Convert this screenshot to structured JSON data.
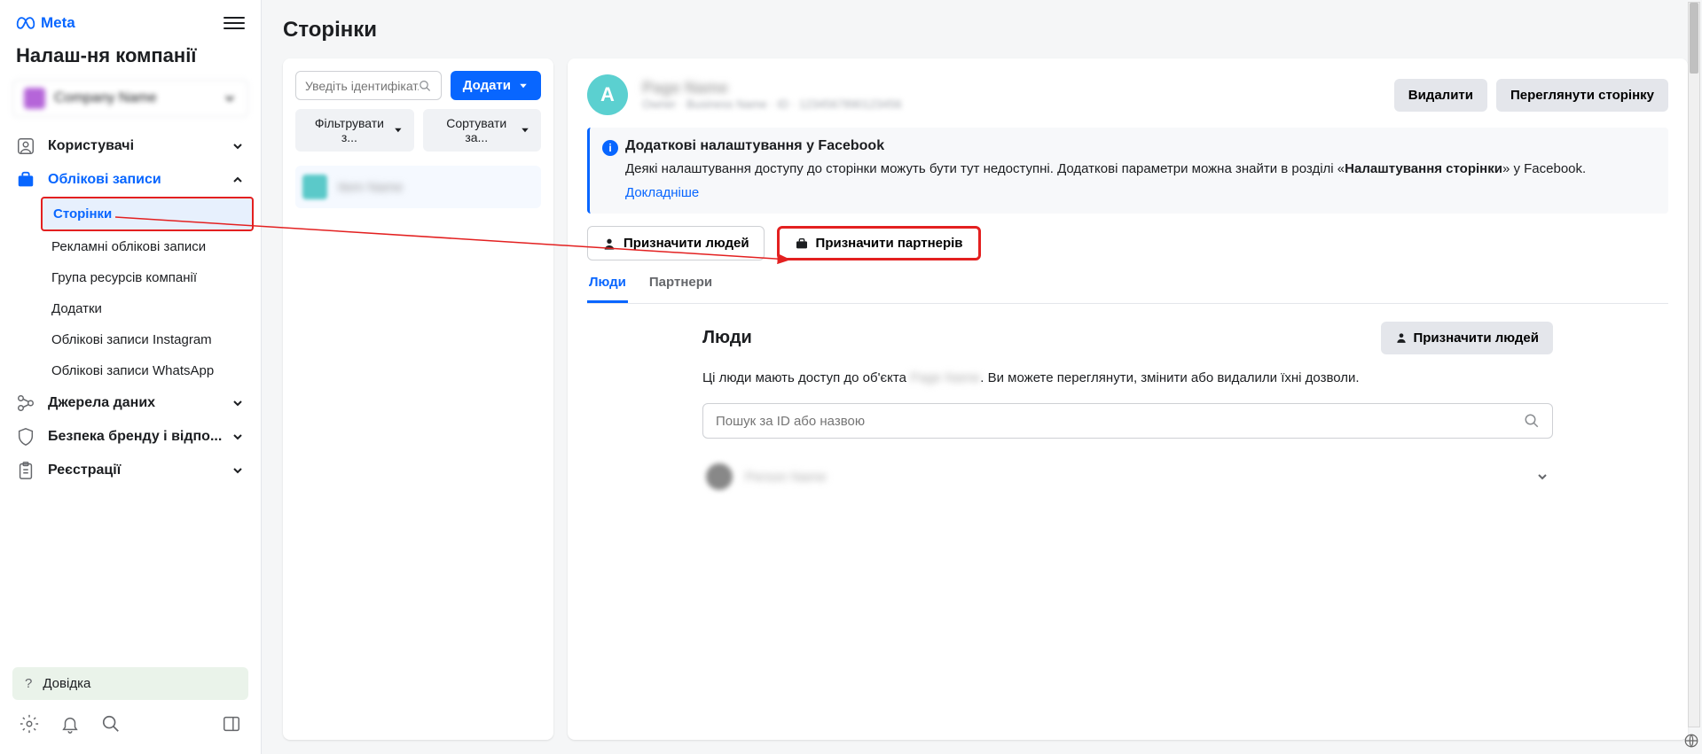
{
  "brand": "Meta",
  "sidebar_title": "Налаш-ня компанії",
  "company_name": "Company Name",
  "nav": {
    "users": "Користувачі",
    "accounts": "Облікові записи",
    "pages": "Сторінки",
    "ad_accounts": "Рекламні облікові записи",
    "asset_groups": "Група ресурсів компанії",
    "apps": "Додатки",
    "instagram": "Облікові записи Instagram",
    "whatsapp": "Облікові записи WhatsApp",
    "data_sources": "Джерела даних",
    "brand_safety": "Безпека бренду і відпо...",
    "registrations": "Реєстрації"
  },
  "help": "Довідка",
  "main": {
    "title": "Сторінки",
    "search_placeholder": "Уведіть ідентифікат...",
    "add": "Додати",
    "filter": "Фільтрувати з...",
    "sort": "Сортувати за...",
    "item_name": "Item Name"
  },
  "detail": {
    "avatar_letter": "A",
    "delete": "Видалити",
    "view_page": "Переглянути сторінку",
    "info_title": "Додаткові налаштування у Facebook",
    "info_text_1": "Деякі налаштування доступу до сторінки можуть бути тут недоступні. Додаткові параметри можна знайти в розділі «",
    "info_text_bold": "Налаштування сторінки",
    "info_text_2": "» у Facebook.",
    "info_link": "Докладніше",
    "assign_people": "Призначити людей",
    "assign_partners": "Призначити партнерів",
    "tab_people": "Люди",
    "tab_partners": "Партнери"
  },
  "people": {
    "heading": "Люди",
    "assign_btn": "Призначити людей",
    "desc_1": "Ці люди мають доступ до об'єкта ",
    "desc_2": ". Ви можете переглянути, змінити або видалили їхні дозволи.",
    "search_placeholder": "Пошук за ID або назвою"
  }
}
